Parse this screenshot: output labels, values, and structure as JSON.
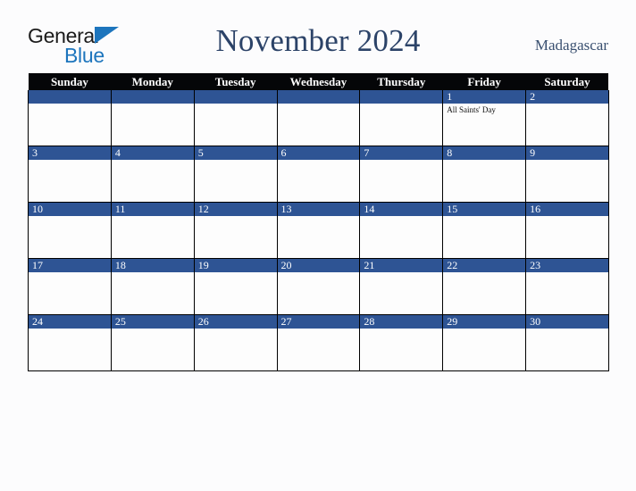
{
  "brand": {
    "name_part1": "General",
    "name_part2": "Blue",
    "triangle_color": "#1d75bd"
  },
  "header": {
    "title": "November 2024",
    "country": "Madagascar"
  },
  "colors": {
    "page_background": "#fcfcfd",
    "header_row_background": "#050608",
    "date_bar_blue": "#2e5494",
    "title_navy": "#2c4368",
    "grid_border": "#000000",
    "cell_background": "#fdfdfd"
  },
  "calendar": {
    "weekday_headers": [
      "Sunday",
      "Monday",
      "Tuesday",
      "Wednesday",
      "Thursday",
      "Friday",
      "Saturday"
    ],
    "weeks": [
      [
        {
          "date": "",
          "events": []
        },
        {
          "date": "",
          "events": []
        },
        {
          "date": "",
          "events": []
        },
        {
          "date": "",
          "events": []
        },
        {
          "date": "",
          "events": []
        },
        {
          "date": "1",
          "events": [
            "All Saints' Day"
          ]
        },
        {
          "date": "2",
          "events": []
        }
      ],
      [
        {
          "date": "3",
          "events": []
        },
        {
          "date": "4",
          "events": []
        },
        {
          "date": "5",
          "events": []
        },
        {
          "date": "6",
          "events": []
        },
        {
          "date": "7",
          "events": []
        },
        {
          "date": "8",
          "events": []
        },
        {
          "date": "9",
          "events": []
        }
      ],
      [
        {
          "date": "10",
          "events": []
        },
        {
          "date": "11",
          "events": []
        },
        {
          "date": "12",
          "events": []
        },
        {
          "date": "13",
          "events": []
        },
        {
          "date": "14",
          "events": []
        },
        {
          "date": "15",
          "events": []
        },
        {
          "date": "16",
          "events": []
        }
      ],
      [
        {
          "date": "17",
          "events": []
        },
        {
          "date": "18",
          "events": []
        },
        {
          "date": "19",
          "events": []
        },
        {
          "date": "20",
          "events": []
        },
        {
          "date": "21",
          "events": []
        },
        {
          "date": "22",
          "events": []
        },
        {
          "date": "23",
          "events": []
        }
      ],
      [
        {
          "date": "24",
          "events": []
        },
        {
          "date": "25",
          "events": []
        },
        {
          "date": "26",
          "events": []
        },
        {
          "date": "27",
          "events": []
        },
        {
          "date": "28",
          "events": []
        },
        {
          "date": "29",
          "events": []
        },
        {
          "date": "30",
          "events": []
        }
      ]
    ]
  }
}
